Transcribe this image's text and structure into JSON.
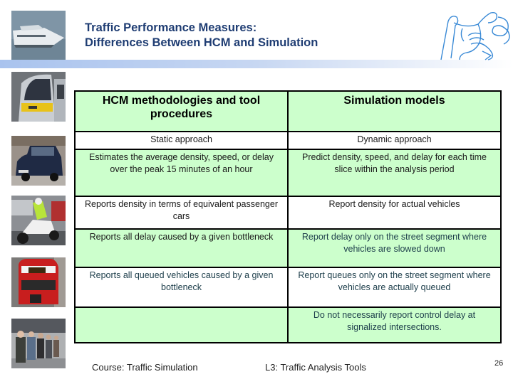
{
  "slide": {
    "title_line1": "Traffic Performance Measures:",
    "title_line2": "Differences Between HCM and Simulation",
    "colors": {
      "title": "#1f3d73",
      "accent_bar": "#a9c3ee",
      "table_green": "#ccffcc",
      "table_border": "#000000",
      "logo": "#3a8ad6"
    }
  },
  "images": {
    "top": "boat-photo",
    "side": [
      "tram-photo",
      "taxi-photo",
      "police-motorcycle-photo",
      "double-decker-bus-photo",
      "queue-of-people-photo"
    ],
    "logo": "ctu-lion-logo"
  },
  "table": {
    "headers": [
      "HCM methodologies and tool procedures",
      "Simulation models"
    ],
    "rows": [
      [
        "Static approach",
        "Dynamic approach"
      ],
      [
        "Estimates the average density, speed, or delay over the peak 15 minutes of an hour",
        "Predict density, speed, and delay for each time slice within the analysis period"
      ],
      [
        "Reports density in terms of equivalent passenger cars",
        "Report density for actual vehicles"
      ],
      [
        "Reports all delay caused by a given bottleneck",
        "Report delay only on the street segment where vehicles are slowed down"
      ],
      [
        "Reports all queued vehicles caused by a given bottleneck",
        "Report queues only on the street segment where vehicles are actually queued"
      ],
      [
        "",
        "Do not necessarily report control delay at signalized intersections."
      ]
    ]
  },
  "footer": {
    "course": "Course: Traffic Simulation",
    "lecture": "L3: Traffic Analysis Tools",
    "page_number": "26"
  }
}
